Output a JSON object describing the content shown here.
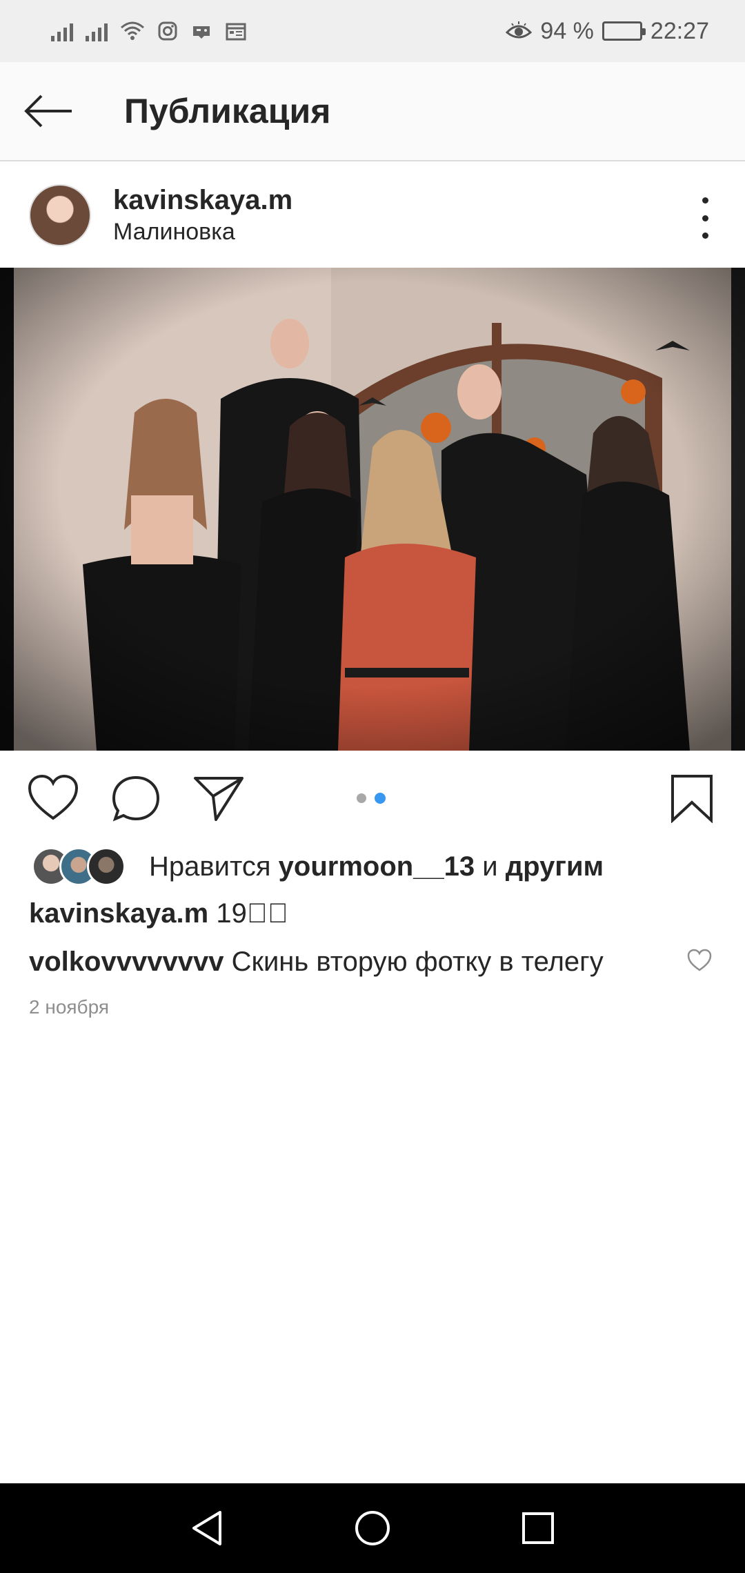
{
  "status_bar": {
    "battery_percent": "94 %",
    "time": "22:27",
    "icons": [
      "signal-icon",
      "signal-icon",
      "wifi-icon",
      "instagram-icon",
      "game-icon",
      "calendar-icon",
      "eye-icon",
      "battery-icon"
    ]
  },
  "header": {
    "title": "Публикация",
    "back_icon": "arrow-left-icon"
  },
  "post": {
    "username": "kavinskaya.m",
    "location": "Малиновка",
    "more_icon": "more-vertical-icon",
    "carousel": {
      "total": 2,
      "active_index": 2
    },
    "actions": [
      "heart-icon",
      "comment-icon",
      "share-icon",
      "bookmark-icon"
    ],
    "likes": {
      "prefix": "Нравится",
      "user": "yourmoon__13",
      "conj": "и",
      "others": "другим"
    },
    "caption": {
      "user": "kavinskaya.m",
      "text": "19\u0000\u0000"
    },
    "comment": {
      "user": "volkovvvvvvvv",
      "text": "Скинь вторую фотку в телегу"
    },
    "date": "2 ноября"
  },
  "colors": {
    "accent": "#3897f0",
    "text": "#262626",
    "muted": "#8e8e8e",
    "status_bg": "#efefef"
  }
}
